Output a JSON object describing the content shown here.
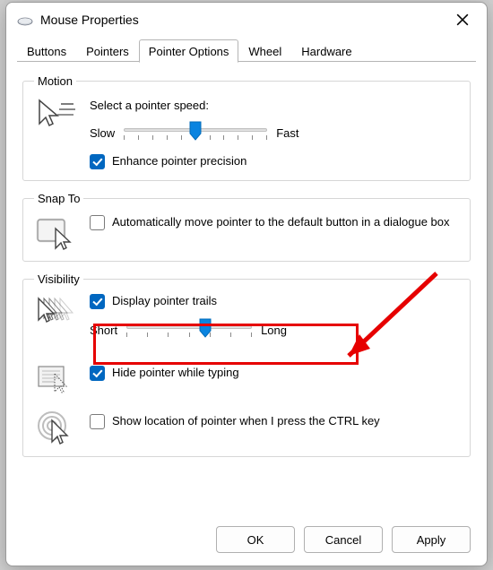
{
  "window": {
    "title": "Mouse Properties"
  },
  "tabs": [
    {
      "label": "Buttons"
    },
    {
      "label": "Pointers"
    },
    {
      "label": "Pointer Options"
    },
    {
      "label": "Wheel"
    },
    {
      "label": "Hardware"
    }
  ],
  "motion": {
    "legend": "Motion",
    "speed_label": "Select a pointer speed:",
    "slow": "Slow",
    "fast": "Fast",
    "slider_pos_pct": 50,
    "enhance_label": "Enhance pointer precision",
    "enhance_checked": true
  },
  "snapto": {
    "legend": "Snap To",
    "auto_label": "Automatically move pointer to the default button in a dialogue box",
    "auto_checked": false
  },
  "visibility": {
    "legend": "Visibility",
    "trails_label": "Display pointer trails",
    "trails_checked": true,
    "short": "Short",
    "long": "Long",
    "trails_slider_pos_pct": 63,
    "hide_label": "Hide pointer while typing",
    "hide_checked": true,
    "ctrl_label": "Show location of pointer when I press the CTRL key",
    "ctrl_checked": false
  },
  "buttons": {
    "ok": "OK",
    "cancel": "Cancel",
    "apply": "Apply"
  }
}
